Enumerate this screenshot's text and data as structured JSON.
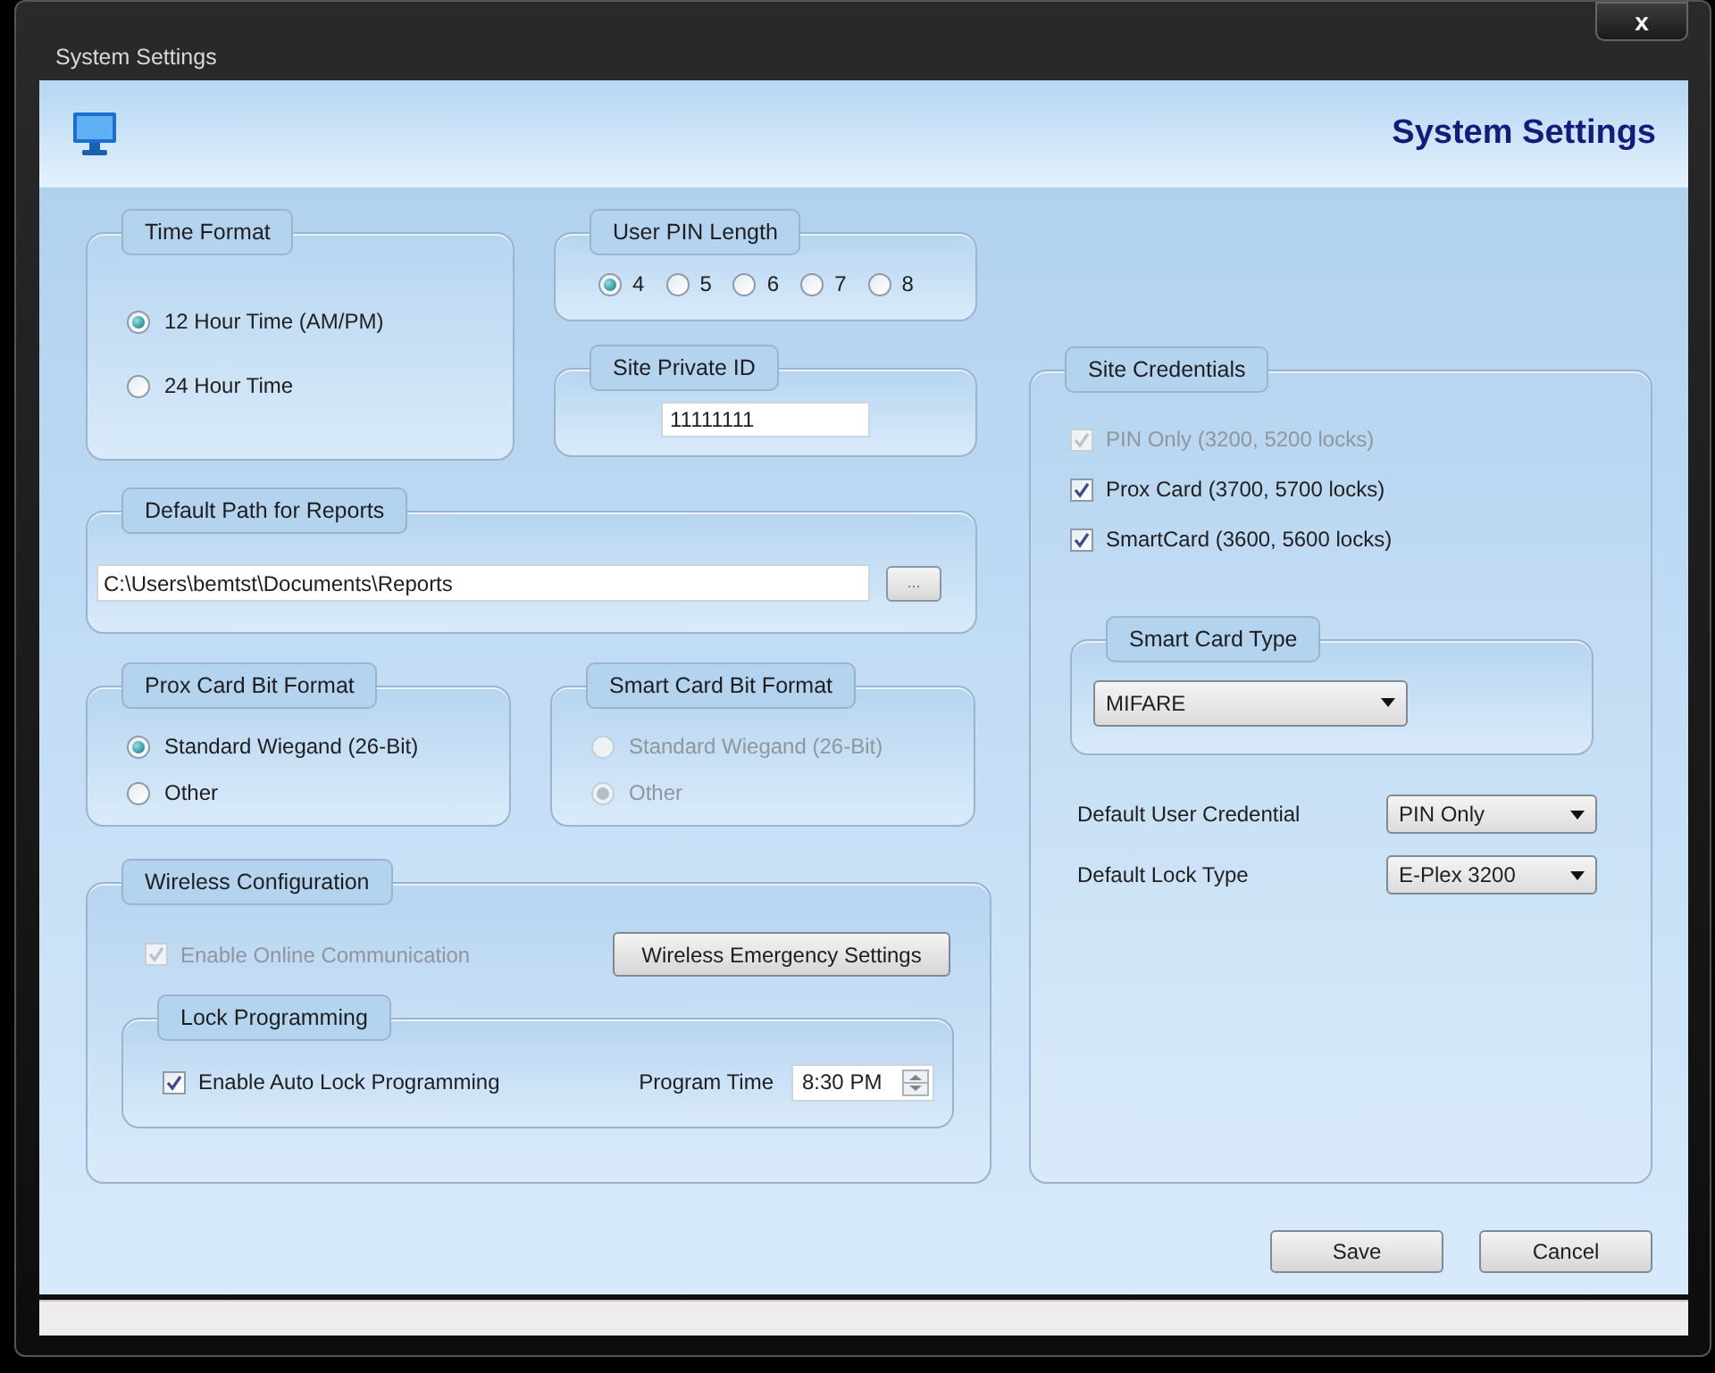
{
  "window": {
    "title": "System Settings",
    "close_button": "x"
  },
  "header": {
    "title": "System Settings"
  },
  "time_format": {
    "title": "Time Format",
    "options": [
      {
        "label": "12 Hour Time (AM/PM)",
        "selected": true,
        "disabled": false
      },
      {
        "label": "24 Hour Time",
        "selected": false,
        "disabled": false
      }
    ]
  },
  "user_pin_length": {
    "title": "User PIN Length",
    "options": [
      {
        "label": "4",
        "selected": true
      },
      {
        "label": "5",
        "selected": false
      },
      {
        "label": "6",
        "selected": false
      },
      {
        "label": "7",
        "selected": false
      },
      {
        "label": "8",
        "selected": false
      }
    ]
  },
  "site_private_id": {
    "title": "Site Private ID",
    "value": "11111111"
  },
  "report_path": {
    "title": "Default Path for Reports",
    "value": "C:\\Users\\bemtst\\Documents\\Reports",
    "browse_button": "..."
  },
  "prox_card_bit_format": {
    "title": "Prox Card Bit Format",
    "options": [
      {
        "label": "Standard Wiegand (26-Bit)",
        "selected": true,
        "disabled": false
      },
      {
        "label": "Other",
        "selected": false,
        "disabled": false
      }
    ]
  },
  "smart_card_bit_format": {
    "title": "Smart Card Bit Format",
    "options": [
      {
        "label": "Standard Wiegand (26-Bit)",
        "selected": false,
        "disabled": true
      },
      {
        "label": "Other",
        "selected": true,
        "disabled": true
      }
    ]
  },
  "wireless_configuration": {
    "title": "Wireless Configuration",
    "online": {
      "label": "Enable Online Communication",
      "checked": true,
      "disabled": true
    },
    "emergency_button": "Wireless Emergency Settings",
    "lock_programming": {
      "title": "Lock Programming",
      "auto": {
        "label": "Enable Auto Lock Programming",
        "checked": true,
        "disabled": false
      },
      "time_label": "Program Time",
      "time_value": "8:30 PM"
    }
  },
  "site_credentials": {
    "title": "Site Credentials",
    "options": [
      {
        "label": "PIN Only (3200, 5200 locks)",
        "checked": true,
        "disabled": true
      },
      {
        "label": "Prox Card (3700, 5700 locks)",
        "checked": true,
        "disabled": false
      },
      {
        "label": "SmartCard (3600, 5600 locks)",
        "checked": true,
        "disabled": false
      }
    ],
    "smart_card_type": {
      "title": "Smart Card Type",
      "value": "MIFARE"
    },
    "fields": [
      {
        "label": "Default User Credential",
        "value": "PIN Only"
      },
      {
        "label": "Default Lock Type",
        "value": "E-Plex 3200"
      }
    ]
  },
  "buttons": [
    "Save",
    "Cancel"
  ]
}
